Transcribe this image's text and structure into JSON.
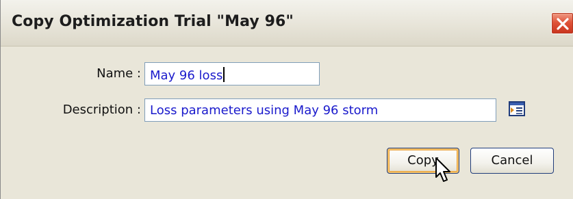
{
  "dialog": {
    "title": "Copy Optimization Trial \"May 96\"",
    "close_icon": "close-icon"
  },
  "form": {
    "name_label": "Name :",
    "name_value": "May 96 loss",
    "description_label": "Description :",
    "description_value": "Loss parameters using May 96 storm",
    "description_editor_icon": "text-editor-icon"
  },
  "buttons": {
    "copy_label": "Copy",
    "cancel_label": "Cancel"
  },
  "colors": {
    "dialog_background": "#e9e6d9",
    "input_text": "#1a1acc",
    "close_button": "#d84a30",
    "focus_ring": "#f6c36a"
  }
}
